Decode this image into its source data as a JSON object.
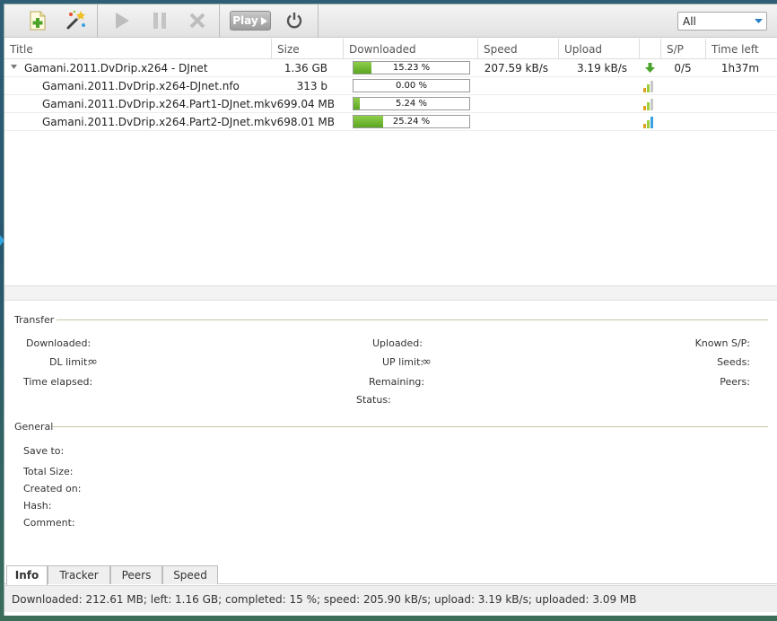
{
  "toolbar": {
    "play_label": "Play",
    "filter_value": "All",
    "icons": [
      "add-torrent-icon",
      "magic-wand-icon",
      "play-icon",
      "pause-icon",
      "stop-icon",
      "power-icon"
    ]
  },
  "columns": [
    "Title",
    "Size",
    "Downloaded",
    "Speed",
    "Upload",
    "S/P",
    "Time left"
  ],
  "rows": [
    {
      "title": "Gamani.2011.DvDrip.x264 - DJnet",
      "size": "1.36 GB",
      "progress": 15.23,
      "progress_text": "15.23 %",
      "speed": "207.59 kB/s",
      "upload": "3.19 kB/s",
      "sp": "0/5",
      "time_left": "1h37m",
      "status_icon": "download-arrow-icon"
    },
    {
      "title": "Gamani.2011.DvDrip.x264-DJnet.nfo",
      "size": "313 b",
      "progress": 0.0,
      "progress_text": "0.00 %",
      "status_icon": "priority-signal-icon"
    },
    {
      "title": "Gamani.2011.DvDrip.x264.Part1-DJnet.mkv",
      "size": "699.04 MB",
      "progress": 5.24,
      "progress_text": "5.24 %",
      "status_icon": "priority-signal-icon"
    },
    {
      "title": "Gamani.2011.DvDrip.x264.Part2-DJnet.mkv",
      "size": "698.01 MB",
      "progress": 25.24,
      "progress_text": "25.24 %",
      "status_icon": "priority-signal-icon"
    }
  ],
  "info": {
    "transfer_title": "Transfer",
    "downloaded": "Downloaded:",
    "dl_limit": "DL limit:",
    "dl_limit_value": "∞",
    "time_elapsed": "Time elapsed:",
    "uploaded": "Uploaded:",
    "up_limit": "UP limit:",
    "up_limit_value": "∞",
    "remaining": "Remaining:",
    "status": "Status:",
    "known_sp": "Known S/P:",
    "seeds": "Seeds:",
    "peers": "Peers:",
    "general_title": "General",
    "save_to": "Save to:",
    "total_size": "Total Size:",
    "created_on": "Created on:",
    "hash": "Hash:",
    "comment": "Comment:"
  },
  "tabs": [
    "Info",
    "Tracker",
    "Peers",
    "Speed"
  ],
  "status_bar": "Downloaded: 212.61 MB; left: 1.16 GB; completed: 15 %; speed: 205.90 kB/s; upload: 3.19 kB/s; uploaded: 3.09 MB",
  "colors": {
    "progress": "#6cb52f",
    "accent": "#2fa5e0"
  }
}
